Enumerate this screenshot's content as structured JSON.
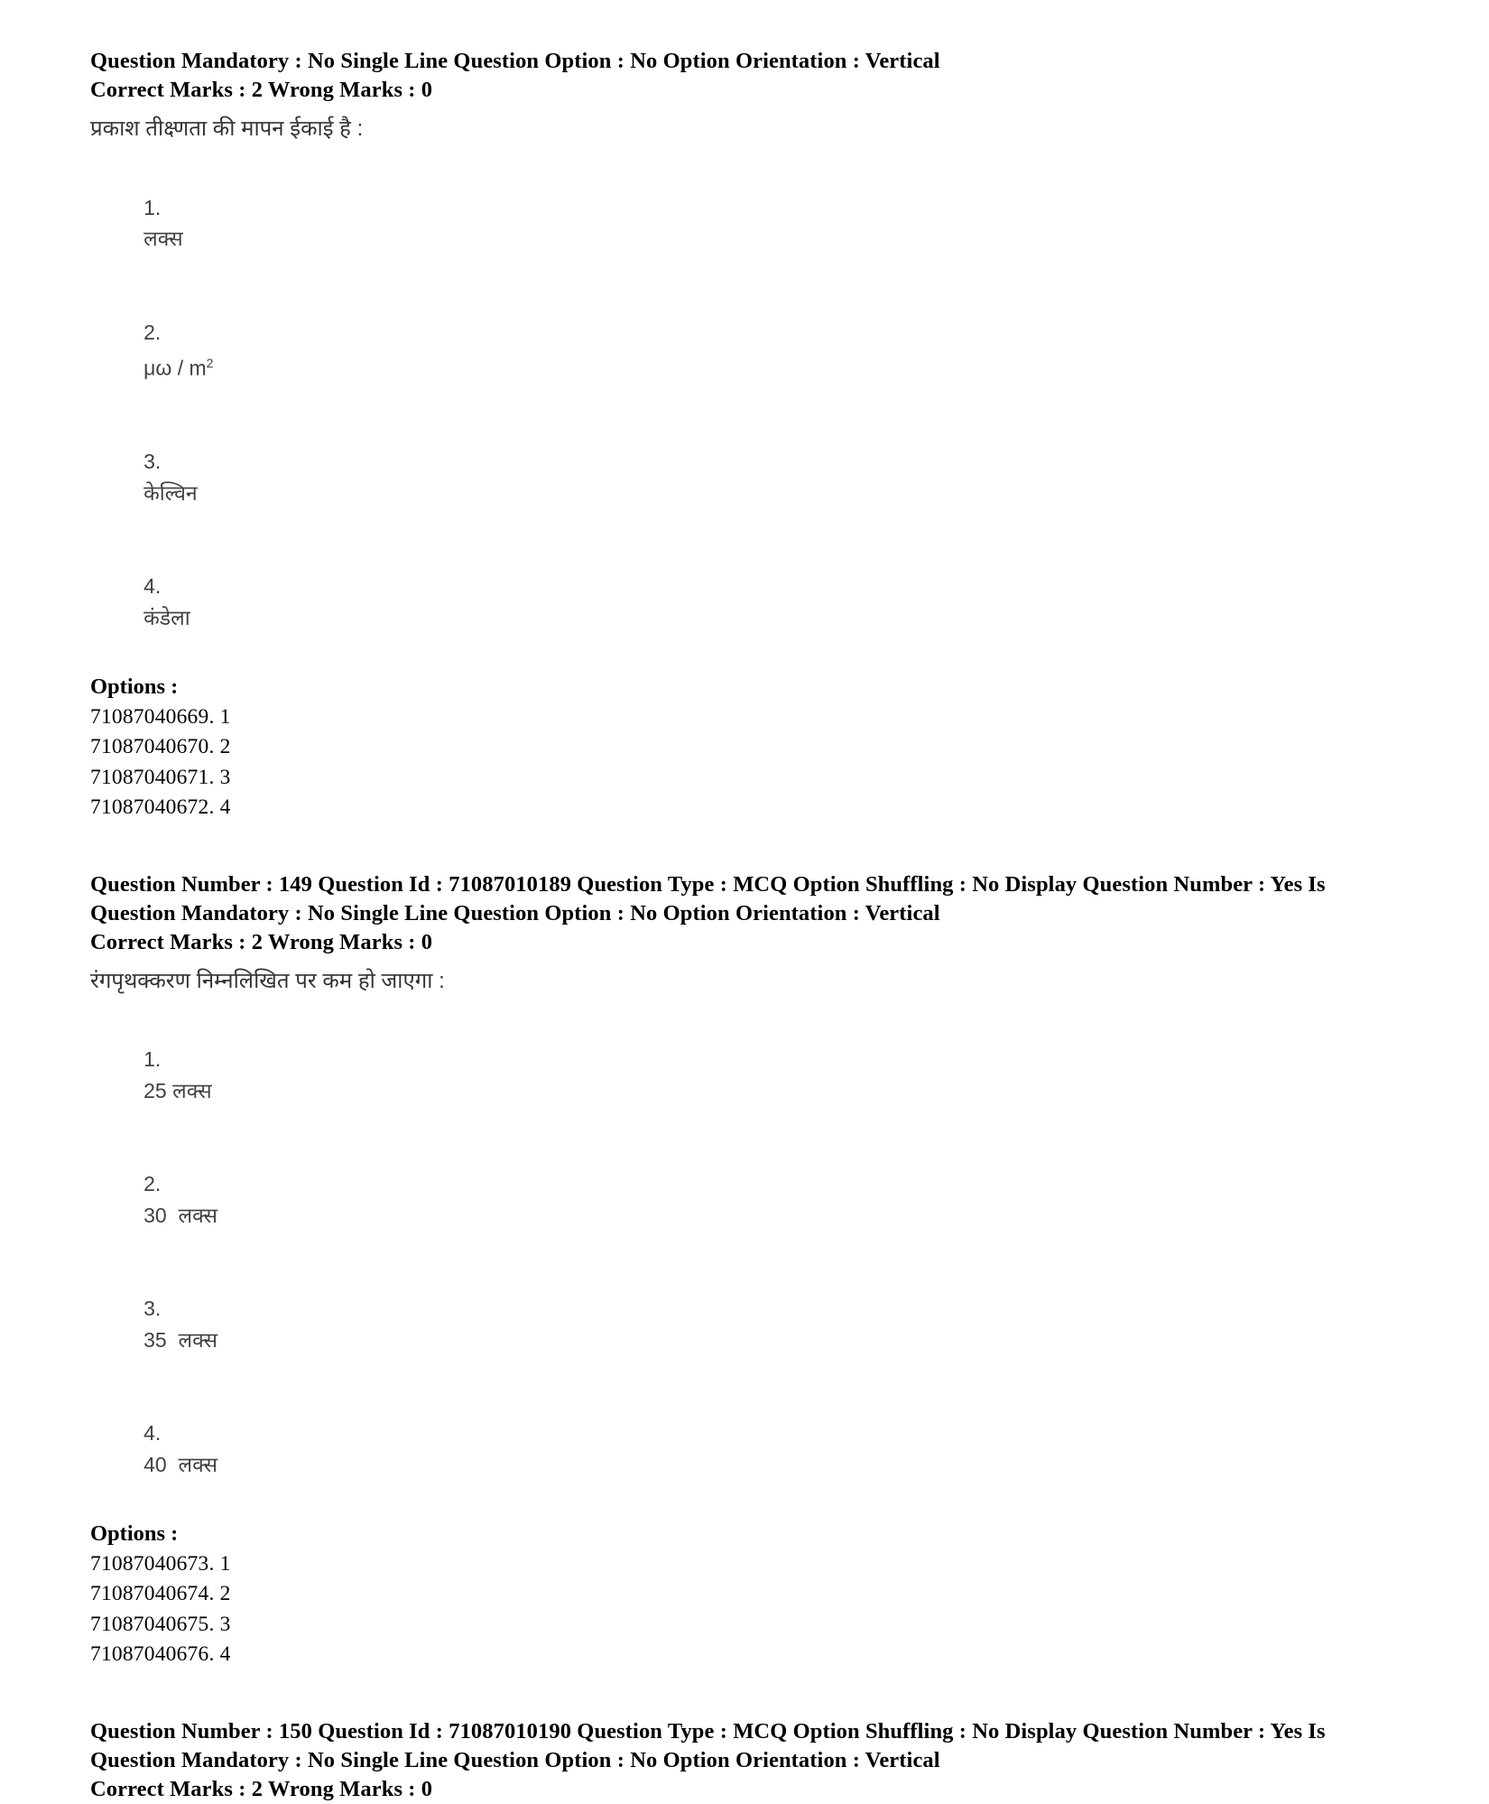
{
  "document": {
    "type": "exam-answer-key-document",
    "background_color": "#ffffff",
    "text_color": "#000000"
  },
  "questions": [
    {
      "id": "q148-partial",
      "meta_lines": [
        "Question Mandatory : No Single Line Question Option : No Option Orientation : Vertical",
        "Correct Marks : 2 Wrong Marks : 0"
      ],
      "question_text": "प्रकाश तीक्ष्णता की मापन ईकाई है :",
      "choices": [
        {
          "number": "1.",
          "text": "लक्स"
        },
        {
          "number": "2.",
          "text": "μω / m",
          "superscript": "2"
        },
        {
          "number": "3.",
          "text": "केल्विन"
        },
        {
          "number": "4.",
          "text": "कंडेला"
        }
      ],
      "options_label": "Options :",
      "option_ids": [
        "71087040669. 1",
        "71087040670. 2",
        "71087040671. 3",
        "71087040672. 4"
      ]
    },
    {
      "id": "q149",
      "meta_lines": [
        "Question Number : 149 Question Id : 71087010189 Question Type : MCQ Option Shuffling : No Display Question Number : Yes Is",
        "Question Mandatory : No Single Line Question Option : No Option Orientation : Vertical",
        "Correct Marks : 2 Wrong Marks : 0"
      ],
      "question_text": "रंगपृथक्करण निम्नलिखित पर कम हो जाएगा :",
      "choices": [
        {
          "number": "1.",
          "text": "25 लक्स"
        },
        {
          "number": "2.",
          "text": "30  लक्स"
        },
        {
          "number": "3.",
          "text": "35  लक्स"
        },
        {
          "number": "4.",
          "text": "40  लक्स"
        }
      ],
      "options_label": "Options :",
      "option_ids": [
        "71087040673. 1",
        "71087040674. 2",
        "71087040675. 3",
        "71087040676. 4"
      ]
    },
    {
      "id": "q150",
      "meta_lines": [
        "Question Number : 150 Question Id : 71087010190 Question Type : MCQ Option Shuffling : No Display Question Number : Yes Is",
        "Question Mandatory : No Single Line Question Option : No Option Orientation : Vertical",
        "Correct Marks : 2 Wrong Marks : 0"
      ]
    }
  ]
}
